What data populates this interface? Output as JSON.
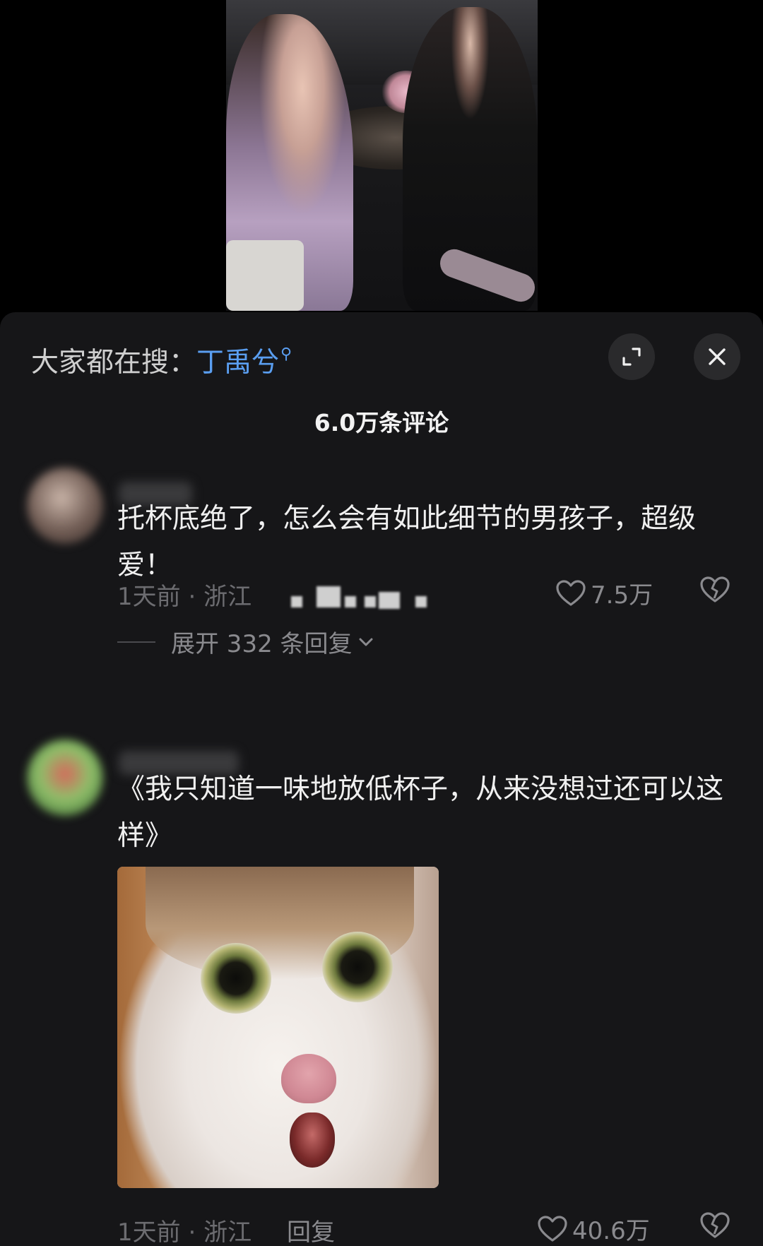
{
  "search": {
    "prefix": "大家都在搜：",
    "keyword": "丁禹兮",
    "icon": "search-icon"
  },
  "sheet": {
    "title": "6.0万条评论"
  },
  "comments": [
    {
      "text": "托杯底绝了，怎么会有如此细节的男孩子，超级爱！",
      "time": "1天前",
      "location": "浙江",
      "likes": "7.5万",
      "expand_label": "展开 332 条回复"
    },
    {
      "text": "《我只知道一味地放低杯子，从来没想过还可以这样》",
      "time": "1天前",
      "location": "浙江",
      "reply_label": "回复",
      "likes": "40.6万"
    }
  ],
  "colors": {
    "keyword": "#5a9ef0",
    "sheet_bg": "#161618",
    "meta": "#6c6c70"
  }
}
